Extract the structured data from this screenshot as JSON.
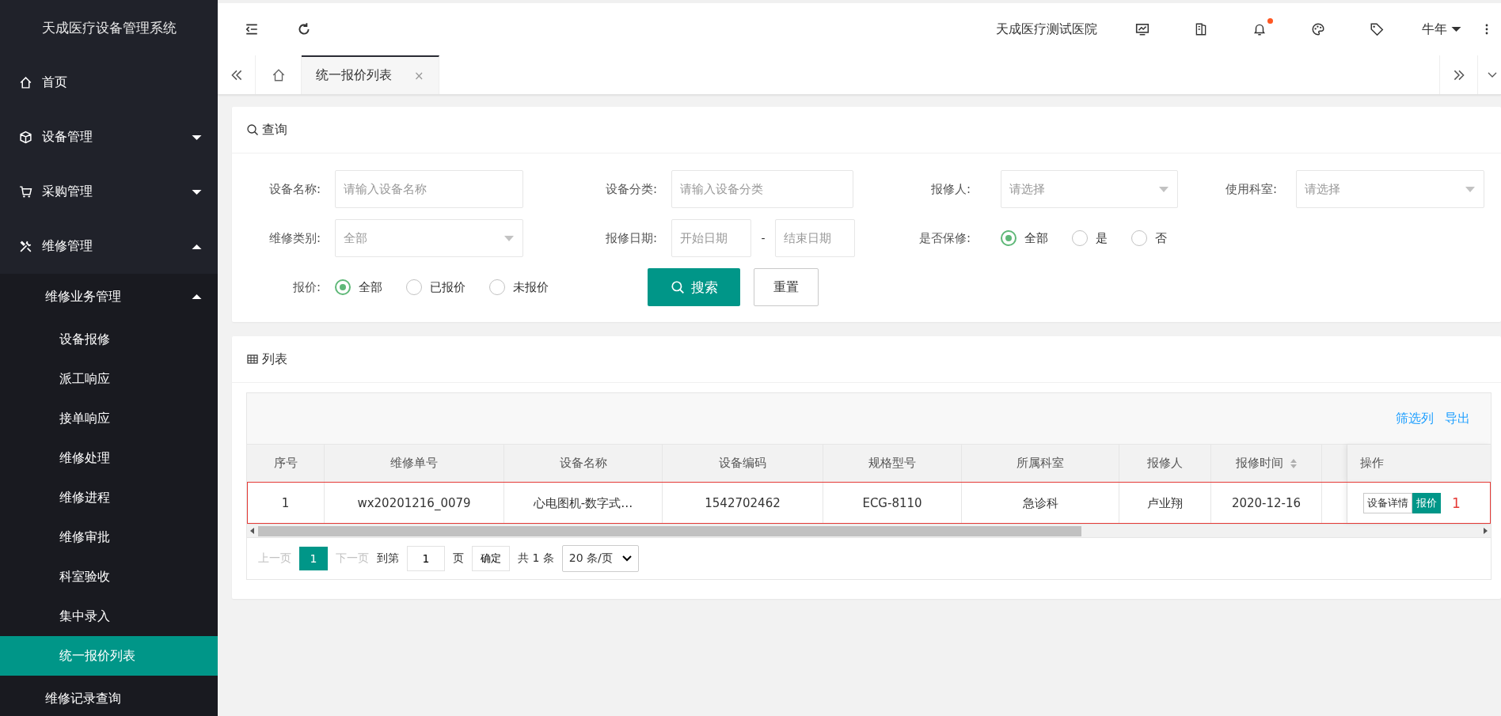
{
  "sidebar": {
    "title": "天成医疗设备管理系统",
    "items": [
      {
        "label": "首页",
        "kind": "link",
        "selected": false
      },
      {
        "label": "设备管理",
        "kind": "group",
        "expanded": false,
        "selected": false
      },
      {
        "label": "采购管理",
        "kind": "group",
        "expanded": false,
        "selected": false
      },
      {
        "label": "维修管理",
        "kind": "group",
        "expanded": true,
        "selected": false,
        "children": [
          {
            "label": "维修业务管理",
            "kind": "group",
            "expanded": true,
            "selected": false,
            "children": [
              {
                "label": "设备报修",
                "kind": "link",
                "selected": false
              },
              {
                "label": "派工响应",
                "kind": "link",
                "selected": false
              },
              {
                "label": "接单响应",
                "kind": "link",
                "selected": false
              },
              {
                "label": "维修处理",
                "kind": "link",
                "selected": false
              },
              {
                "label": "维修进程",
                "kind": "link",
                "selected": false
              },
              {
                "label": "维修审批",
                "kind": "link",
                "selected": false
              },
              {
                "label": "科室验收",
                "kind": "link",
                "selected": false
              },
              {
                "label": "集中录入",
                "kind": "link",
                "selected": false
              },
              {
                "label": "统一报价列表",
                "kind": "link",
                "selected": true
              }
            ]
          },
          {
            "label": "维修记录查询",
            "kind": "link",
            "selected": false
          }
        ]
      }
    ]
  },
  "header": {
    "hospital": "天成医疗测试医院",
    "notification_dot": true,
    "user": "牛年"
  },
  "tabs": [
    {
      "kind": "home",
      "selected": false
    },
    {
      "kind": "page",
      "label": "统一报价列表",
      "close": "×",
      "selected": true
    }
  ],
  "query": {
    "title": "查询",
    "fields": [
      {
        "kind": "input",
        "label": "设备名称:",
        "placeholder": "请输入设备名称"
      },
      {
        "kind": "input",
        "label": "设备分类:",
        "placeholder": "请输入设备分类"
      },
      {
        "kind": "select",
        "label": "报修人:",
        "placeholder": "请选择"
      },
      {
        "kind": "select",
        "label": "使用科室:",
        "placeholder": "请选择"
      },
      {
        "kind": "select",
        "label": "维修类别:",
        "value": "全部"
      },
      {
        "kind": "daterange",
        "label": "报修日期:",
        "start_placeholder": "开始日期",
        "separator": "-",
        "end_placeholder": "结束日期"
      },
      {
        "kind": "radio",
        "label": "是否保修:",
        "options": [
          {
            "label": "全部",
            "selected": true
          },
          {
            "label": "是",
            "selected": false
          },
          {
            "label": "否",
            "selected": false
          }
        ]
      },
      {
        "kind": "radio",
        "label": "报价:",
        "options": [
          {
            "label": "全部",
            "selected": true
          },
          {
            "label": "已报价",
            "selected": false
          },
          {
            "label": "未报价",
            "selected": false
          }
        ]
      }
    ],
    "search_button": "搜索",
    "reset_button": "重置"
  },
  "list": {
    "title": "列表",
    "toolbar_links": [
      "筛选列",
      "导出"
    ],
    "columns": [
      {
        "label": "序号",
        "sortable": false
      },
      {
        "label": "维修单号",
        "sortable": false
      },
      {
        "label": "设备名称",
        "sortable": false
      },
      {
        "label": "设备编码",
        "sortable": false
      },
      {
        "label": "规格型号",
        "sortable": false
      },
      {
        "label": "所属科室",
        "sortable": false
      },
      {
        "label": "报修人",
        "sortable": false
      },
      {
        "label": "报修时间",
        "sortable": true
      },
      {
        "label": "操作",
        "sortable": false
      }
    ],
    "rows": [
      {
        "cells": [
          "1",
          "wx20201216_0079",
          "心电图机-数字式…",
          "1542702462",
          "ECG-8110",
          "急诊科",
          "卢业翔",
          "2020-12-16"
        ],
        "actions": [
          "设备详情",
          "报价"
        ],
        "highlighted": true,
        "annotation": "1"
      }
    ],
    "pager": {
      "prev": "上一页",
      "pages": [
        {
          "label": "1",
          "selected": true
        }
      ],
      "next": "下一页",
      "goto_label": "到第",
      "goto_value": "1",
      "page_unit": "页",
      "confirm": "确定",
      "total": "共 1 条",
      "page_size": "20 条/页"
    }
  }
}
